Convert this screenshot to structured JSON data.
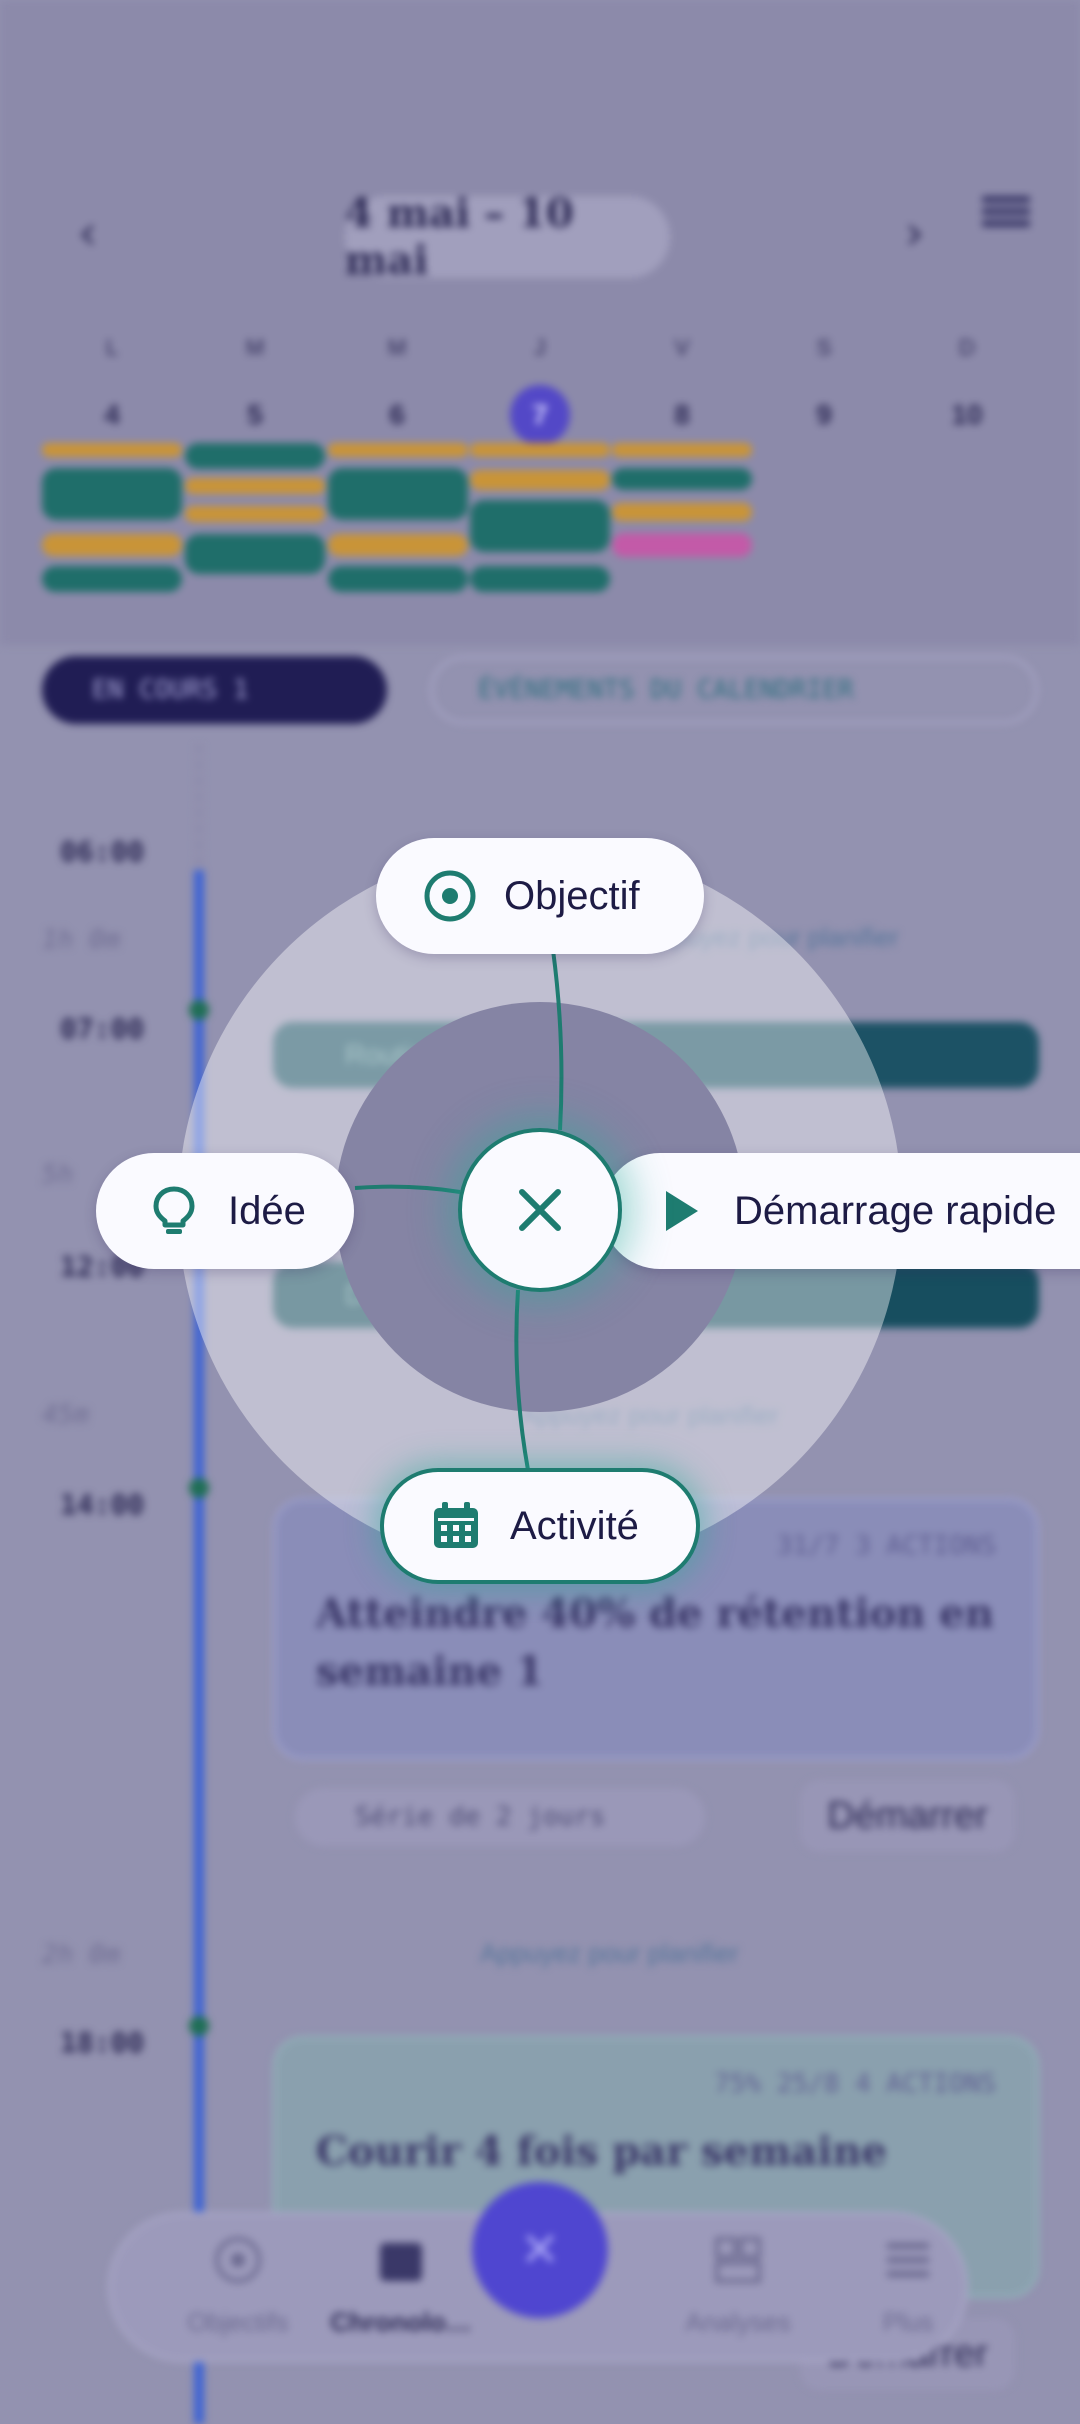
{
  "week": {
    "range_label": "4 mai – 10 mai",
    "days": [
      {
        "letter": "L",
        "num": "4"
      },
      {
        "letter": "M",
        "num": "5"
      },
      {
        "letter": "M",
        "num": "6"
      },
      {
        "letter": "J",
        "num": "7",
        "selected": true
      },
      {
        "letter": "V",
        "num": "8"
      },
      {
        "letter": "S",
        "num": "9"
      },
      {
        "letter": "D",
        "num": "10"
      }
    ]
  },
  "filters": {
    "in_progress": "EN COURS 1",
    "calendar_events": "ÉVÉNEMENTS DU CALENDRIER"
  },
  "timeline": {
    "times": [
      "06:00",
      "07:00",
      "12:00",
      "14:00",
      "18:00"
    ],
    "durations": [
      "1h 0m",
      "5h",
      "45m",
      "2h 0m"
    ],
    "hint": "Appuyez pour planifier",
    "events": [
      "Routine matinale",
      "Déjeuner"
    ],
    "card1": {
      "meta": "31/7  3 ACTIONS",
      "title": "Atteindre 40% de rétention en semaine 1",
      "streak": "Série de 2 jours",
      "start": "Démarrer"
    },
    "card2": {
      "meta": "75%  25/8  4 ACTIONS",
      "title": "Courir 4 fois par semaine",
      "start": "Démarrer"
    }
  },
  "bottom_nav": {
    "items": [
      "Objectifs",
      "Chronolo…",
      "Analyses",
      "Plus"
    ]
  },
  "radial_menu": {
    "objective": "Objectif",
    "idea": "Idée",
    "quick_start": "Démarrage rapide",
    "activity": "Activité",
    "close_icon": "close-icon"
  },
  "colors": {
    "accent_teal": "#1e7c70",
    "fab_blue": "#4f46d0",
    "overlay": "#9392b0"
  }
}
